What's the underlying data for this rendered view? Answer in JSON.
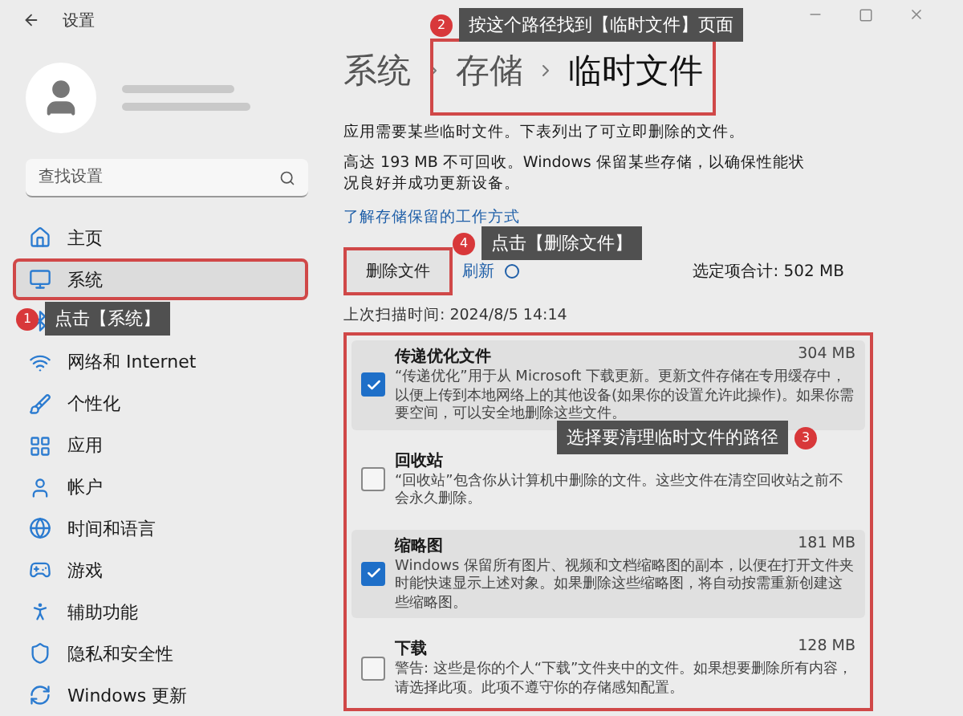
{
  "window": {
    "title": "设置"
  },
  "sidebar": {
    "search": {
      "placeholder": "查找设置"
    },
    "items": [
      {
        "label": "主页",
        "selected": false
      },
      {
        "label": "系统",
        "selected": true
      },
      {
        "selected": false
      },
      {
        "label": "网络和 Internet",
        "selected": false
      },
      {
        "label": "个性化",
        "selected": false
      },
      {
        "label": "应用",
        "selected": false
      },
      {
        "label": "帐户",
        "selected": false
      },
      {
        "label": "时间和语言",
        "selected": false
      },
      {
        "label": "游戏",
        "selected": false
      },
      {
        "label": "辅助功能",
        "selected": false
      },
      {
        "label": "隐私和安全性",
        "selected": false
      },
      {
        "label": "Windows 更新",
        "selected": false
      }
    ]
  },
  "main": {
    "breadcrumb": [
      "系统",
      "存储",
      "临时文件"
    ],
    "descriptions": [
      "应用需要某些临时文件。下表列出了可立即删除的文件。",
      "高达 193 MB 不可回收。Windows 保留某些存储，以确保性能状况良好并成功更新设备。"
    ],
    "link": "了解存储保留的工作方式",
    "delete_button": "删除文件",
    "refresh": "刷新",
    "total": "选定项合计: 502 MB",
    "last_scan": "上次扫描时间: 2024/8/5 14:14",
    "items": [
      {
        "name": "传递优化文件",
        "size": "304 MB",
        "checked": true,
        "description": "“传递优化”用于从 Microsoft 下载更新。更新文件存储在专用缓存中，以便上传到本地网络上的其他设备(如果你的设置允许此操作)。如果你需要空间，可以安全地删除这些文件。"
      },
      {
        "name": "回收站",
        "checked": false,
        "description": "“回收站”包含你从计算机中删除的文件。这些文件在清空回收站之前不会永久删除。"
      },
      {
        "name": "缩略图",
        "size": "181 MB",
        "checked": true,
        "description": "Windows 保留所有图片、视频和文档缩略图的副本，以便在打开文件夹时能快速显示上述对象。如果删除这些缩略图，将自动按需重新创建这些缩略图。"
      },
      {
        "name": "下载",
        "size": "128 MB",
        "checked": false,
        "description": "警告: 这些是你的个人“下载”文件夹中的文件。如果想要删除所有内容，请选择此项。此项不遵守你的存储感知配置。"
      }
    ]
  },
  "annotations": [
    {
      "number": "1",
      "text": "点击【系统】"
    },
    {
      "number": "2",
      "text": "按这个路径找到【临时文件】页面"
    },
    {
      "number": "3",
      "text": "选择要清理临时文件的路径"
    },
    {
      "number": "4",
      "text": "点击【删除文件】"
    }
  ]
}
